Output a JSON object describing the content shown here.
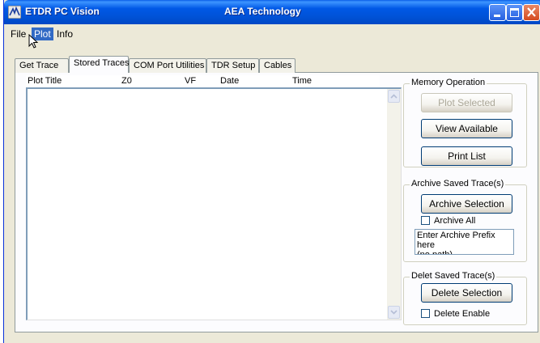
{
  "window": {
    "app_title": "ETDR PC Vision",
    "company": "AEA Technology"
  },
  "menu": {
    "file": "File",
    "plot": "Plot",
    "info": "Info"
  },
  "tabs": [
    {
      "label": "Get Trace"
    },
    {
      "label": "Stored Traces",
      "active": true
    },
    {
      "label": "COM Port Utilities"
    },
    {
      "label": "TDR Setup"
    },
    {
      "label": "Cables"
    }
  ],
  "list": {
    "columns": [
      "Plot Title",
      "Z0",
      "VF",
      "Date",
      "Time"
    ],
    "rows": []
  },
  "memory_operation": {
    "label": "Memory Operation",
    "plot_selected": "Plot Selected",
    "view_available": "View Available",
    "print_list": "Print List"
  },
  "archive": {
    "label": "Archive Saved Trace(s)",
    "archive_selection": "Archive Selection",
    "archive_all": "Archive All",
    "prefix_placeholder": "Enter Archive Prefix here\n(no path)"
  },
  "delete": {
    "label": "Delet Saved Trace(s)",
    "delete_selection": "Delete Selection",
    "delete_enable": "Delete Enable"
  },
  "colors": {
    "titlebar": "#0052D6",
    "menu_highlight": "#316AC5",
    "dialog_bg": "#ECE9D8"
  }
}
